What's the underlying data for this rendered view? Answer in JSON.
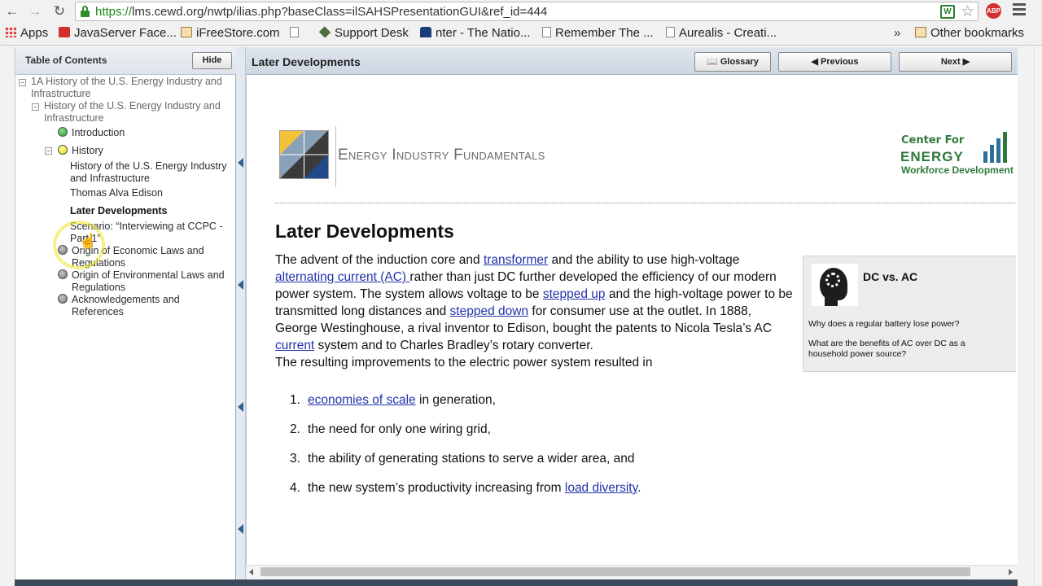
{
  "browser": {
    "url_proto": "https://",
    "url_rest": "lms.cewd.org/nwtp/ilias.php?baseClass=ilSAHSPresentationGUI&ref_id=444",
    "ext_label": "W",
    "abp_label": "ABP",
    "bookmarks": [
      {
        "label": "Apps",
        "icon": "apps-icon"
      },
      {
        "label": "JavaServer Face...",
        "icon": "site-icon"
      },
      {
        "label": "iFreeStore.com",
        "icon": "folder-icon"
      },
      {
        "label": "",
        "icon": "page-icon"
      },
      {
        "label": "Support Desk",
        "icon": "diamond-icon"
      },
      {
        "label": "nter - The Natio...",
        "icon": "house-icon"
      },
      {
        "label": "Remember The ...",
        "icon": "calendar-icon"
      },
      {
        "label": "Aurealis - Creati...",
        "icon": "page-icon"
      }
    ],
    "more_label": "»",
    "other_bookmarks": "Other bookmarks"
  },
  "toc": {
    "title": "Table of Contents",
    "hide_label": "Hide",
    "items": [
      {
        "label": "1A History of the U.S. Energy Industry and Infrastructure"
      },
      {
        "label": "History of the U.S. Energy Industry and Infrastructure"
      },
      {
        "label": "Introduction"
      },
      {
        "label": "History"
      },
      {
        "label": "History of the U.S. Energy Industry and Infrastructure"
      },
      {
        "label": "Thomas Alva Edison"
      },
      {
        "label": "Later Developments"
      },
      {
        "label": "Scenario: “Interviewing at CCPC - Part 1”"
      },
      {
        "label": "Origin of Economic Laws and Regulations"
      },
      {
        "label": "Origin of Environmental Laws and Regulations"
      },
      {
        "label": "Acknowledgements and References"
      }
    ]
  },
  "header": {
    "title": "Later Developments",
    "glossary": "Glossary",
    "previous": "Previous",
    "next": "Next"
  },
  "banner": {
    "title": "Energy Industry Fundamentals",
    "logo_line1": "Center For",
    "logo_line2": "ENERGY",
    "logo_line3": "Workforce Development"
  },
  "main": {
    "heading": "Later Developments",
    "p": {
      "t1": "The advent of the induction core and ",
      "l1": "transformer",
      "t2": " and the ability to use high-voltage ",
      "l2": "alternating current (AC) ",
      "t3": "rather than just DC further developed the efficiency of our modern power system. The system allows voltage to be ",
      "l3": "stepped up",
      "t4": " and the high-voltage power to be transmitted long distances and ",
      "l4": "stepped down",
      "t5": " for consumer use at the outlet. In 1888, George Westinghouse, a rival inventor to Edison, bought the patents to Nicola Tesla’s AC ",
      "l5": "current",
      "t6": " system and to Charles Bradley’s rotary converter.",
      "t7": "The resulting improvements to the electric power system resulted in"
    },
    "list": [
      {
        "num": "1.",
        "link": "economies of scale",
        "text": " in generation,"
      },
      {
        "num": "2.",
        "link": "",
        "text": "the need for only one wiring grid,"
      },
      {
        "num": "3.",
        "link": "",
        "text": "the ability of generating stations to serve a wider area, and"
      },
      {
        "num": "4.",
        "pre": "the new system’s productivity increasing from ",
        "link": "load diversity",
        "text": "."
      }
    ],
    "sidebox": {
      "title": "DC vs. AC",
      "q1": "Why does a regular battery lose power?",
      "q2": "What are the benefits of AC over DC as a household power source?"
    }
  }
}
